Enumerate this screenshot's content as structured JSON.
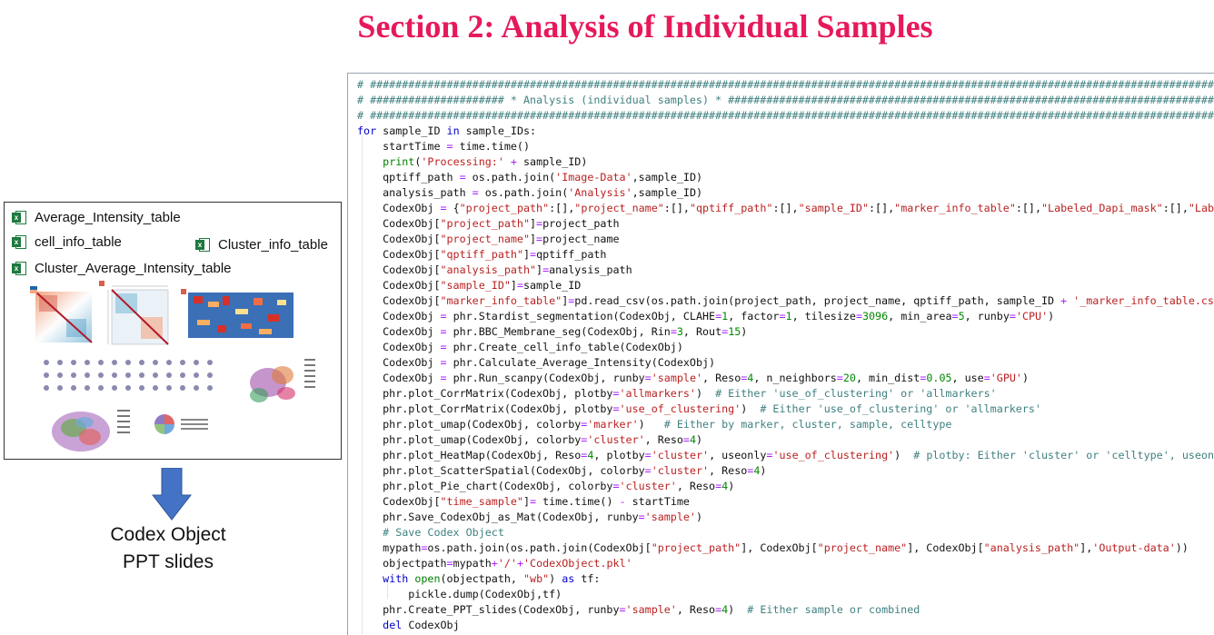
{
  "title": "Section 2: Analysis of Individual Samples",
  "files": [
    {
      "name": "Average_Intensity_table",
      "icon": "excel-icon"
    },
    {
      "name": "cell_info_table",
      "icon": "excel-icon"
    },
    {
      "name": "Cluster_info_table",
      "icon": "excel-icon"
    },
    {
      "name": "Cluster_Average_Intensity_table",
      "icon": "excel-icon"
    }
  ],
  "outputs": [
    "Codex Object",
    "PPT slides"
  ],
  "colors": {
    "title": "#e6195a",
    "arrow": "#4472c4",
    "excel": "#1d7a3e"
  },
  "code_lines": [
    "# ##########################################################################################################################################",
    "# ##################### * Analysis (individual samples) * ####################################################################################",
    "# ##########################################################################################################################################",
    "for sample_ID in sample_IDs:",
    "    startTime = time.time()",
    "    print('Processing:' + sample_ID)",
    "    qptiff_path = os.path.join('Image-Data',sample_ID)",
    "    analysis_path = os.path.join('Analysis',sample_ID)",
    "    CodexObj = {\"project_path\":[],\"project_name\":[],\"qptiff_path\":[],\"sample_ID\":[],\"marker_info_table\":[],\"Labeled_Dapi_mask\":[],\"Labeled",
    "    CodexObj[\"project_path\"]=project_path",
    "    CodexObj[\"project_name\"]=project_name",
    "    CodexObj[\"qptiff_path\"]=qptiff_path",
    "    CodexObj[\"analysis_path\"]=analysis_path",
    "    CodexObj[\"sample_ID\"]=sample_ID",
    "    CodexObj[\"marker_info_table\"]=pd.read_csv(os.path.join(project_path, project_name, qptiff_path, sample_ID + '_marker_info_table.csv')",
    "    CodexObj = phr.Stardist_segmentation(CodexObj, CLAHE=1, factor=1, tilesize=3096, min_area=5, runby='CPU')",
    "    CodexObj = phr.BBC_Membrane_seg(CodexObj, Rin=3, Rout=15)",
    "    CodexObj = phr.Create_cell_info_table(CodexObj)",
    "    CodexObj = phr.Calculate_Average_Intensity(CodexObj)",
    "    CodexObj = phr.Run_scanpy(CodexObj, runby='sample', Reso=4, n_neighbors=20, min_dist=0.05, use='GPU')",
    "    phr.plot_CorrMatrix(CodexObj, plotby='allmarkers')  # Either 'use_of_clustering' or 'allmarkers'",
    "    phr.plot_CorrMatrix(CodexObj, plotby='use_of_clustering')  # Either 'use_of_clustering' or 'allmarkers'",
    "    phr.plot_umap(CodexObj, colorby='marker')   # Either by marker, cluster, sample, celltype",
    "    phr.plot_umap(CodexObj, colorby='cluster', Reso=4)",
    "    phr.plot_HeatMap(CodexObj, Reso=4, plotby='cluster', useonly='use_of_clustering')  # plotby: Either 'cluster' or 'celltype', useonly",
    "    phr.plot_ScatterSpatial(CodexObj, colorby='cluster', Reso=4)",
    "    phr.plot_Pie_chart(CodexObj, colorby='cluster', Reso=4)",
    "    CodexObj[\"time_sample\"]= time.time() - startTime",
    "    phr.Save_CodexObj_as_Mat(CodexObj, runby='sample')",
    "    # Save Codex Object",
    "    mypath=os.path.join(os.path.join(CodexObj[\"project_path\"], CodexObj[\"project_name\"], CodexObj[\"analysis_path\"],'Output-data'))",
    "    objectpath=mypath+'/'+'CodexObject.pkl'",
    "    with open(objectpath, \"wb\") as tf:",
    "        pickle.dump(CodexObj,tf)",
    "    phr.Create_PPT_slides(CodexObj, runby='sample', Reso=4)  # Either sample or combined",
    "    del CodexObj"
  ]
}
